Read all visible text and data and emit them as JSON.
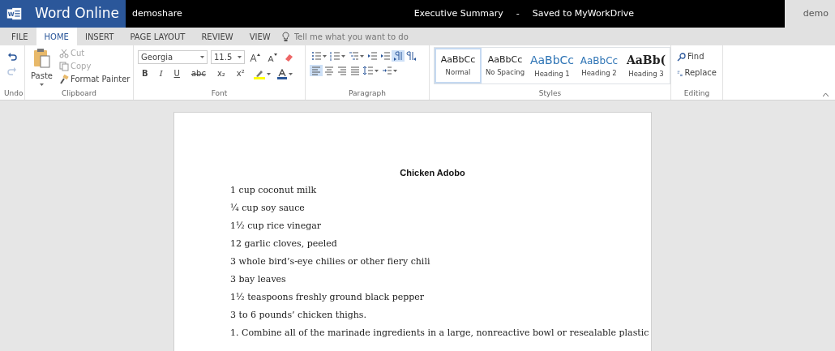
{
  "header": {
    "logo_letter": "W",
    "app_name": "Word Online",
    "site": "demoshare",
    "doc_title": "Executive Summary",
    "separator": "-",
    "save_status": "Saved to MyWorkDrive",
    "user": "demo"
  },
  "tabs": [
    {
      "label": "FILE",
      "selected": false
    },
    {
      "label": "HOME",
      "selected": true
    },
    {
      "label": "INSERT",
      "selected": false
    },
    {
      "label": "PAGE LAYOUT",
      "selected": false
    },
    {
      "label": "REVIEW",
      "selected": false
    },
    {
      "label": "VIEW",
      "selected": false
    }
  ],
  "tell_me": {
    "placeholder": "Tell me what you want to do"
  },
  "ribbon": {
    "undo": {
      "label": "Undo",
      "redo_disabled": true
    },
    "clipboard": {
      "label": "Clipboard",
      "paste": "Paste",
      "items": [
        {
          "kind": "cut",
          "label": "Cut",
          "disabled": true
        },
        {
          "kind": "copy",
          "label": "Copy",
          "disabled": true
        },
        {
          "kind": "painter",
          "label": "Format Painter",
          "disabled": false
        }
      ]
    },
    "font": {
      "label": "Font",
      "font_name": "Georgia",
      "font_size": "11.5",
      "format_buttons": [
        {
          "kind": "bold",
          "label": "B"
        },
        {
          "kind": "italic",
          "label": "I"
        },
        {
          "kind": "underline",
          "label": "U"
        },
        {
          "kind": "strike",
          "label": "abc"
        },
        {
          "kind": "sub",
          "label": "x₂"
        },
        {
          "kind": "sup",
          "label": "x²"
        }
      ]
    },
    "paragraph": {
      "label": "Paragraph",
      "row_1": [
        {
          "kind": "bullets",
          "active": false
        },
        {
          "kind": "numbering",
          "active": false
        },
        {
          "kind": "multilevel",
          "active": false
        },
        {
          "kind": "outdent",
          "active": false
        },
        {
          "kind": "indent",
          "active": false
        },
        {
          "kind": "ltr",
          "active": true
        },
        {
          "kind": "rtl",
          "active": false
        }
      ],
      "row_2": [
        {
          "kind": "align-left",
          "active": true
        },
        {
          "kind": "align-center",
          "active": false
        },
        {
          "kind": "align-right",
          "active": false
        },
        {
          "kind": "justify",
          "active": false
        },
        {
          "kind": "spacing",
          "active": false
        },
        {
          "kind": "para-indent",
          "active": false
        }
      ]
    },
    "styles": {
      "label": "Styles",
      "items": [
        {
          "kind": "normal",
          "sample": "AaBbCc",
          "label": "Normal",
          "selected": true
        },
        {
          "kind": "nospacing",
          "sample": "AaBbCc",
          "label": "No Spacing",
          "selected": false
        },
        {
          "kind": "heading1",
          "sample": "AaBbCc",
          "label": "Heading 1",
          "selected": false
        },
        {
          "kind": "heading2",
          "sample": "AaBbCc",
          "label": "Heading 2",
          "selected": false
        },
        {
          "kind": "heading3",
          "sample": "AaBb(",
          "label": "Heading 3",
          "selected": false
        }
      ]
    },
    "editing": {
      "label": "Editing",
      "find": "Find",
      "replace": "Replace"
    }
  },
  "document": {
    "title": "Chicken Adobo",
    "lines": [
      "1 cup coconut milk",
      "¼ cup soy sauce",
      "1½ cup rice vinegar",
      "12 garlic cloves, peeled",
      "3 whole bird’s-eye chilies or other fiery chili",
      "3 bay leaves",
      "1½ teaspoons freshly ground black pepper",
      "3 to 6 pounds’ chicken thighs.",
      "1. Combine all of the marinade ingredients in a large, nonreactive bowl or resealable plastic"
    ]
  }
}
